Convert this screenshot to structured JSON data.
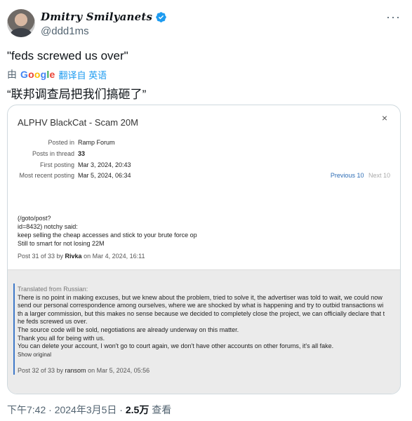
{
  "tweet": {
    "display_name": "Dmitry Smilyanets",
    "handle": "@ddd1ms",
    "more_icon": "ellipsis-icon",
    "text": "\"feds screwed us over\"",
    "translate_by": "由",
    "translate_brand": "Google",
    "translate_link": "翻译自 英语",
    "translated_text": "“联邦调查局把我们搞砸了”",
    "footer_time": "下午7:42 · 2024年3月5日 · ",
    "footer_views_count": "2.5万",
    "footer_views_label": " 查看"
  },
  "card": {
    "title": "ALPHV BlackCat - Scam 20M",
    "close_label": "×",
    "info": [
      {
        "label": "Posted in",
        "value": "Ramp Forum"
      },
      {
        "label": "Posts in thread",
        "value": "33"
      },
      {
        "label": "First posting",
        "value": "Mar 3, 2024, 20:43"
      },
      {
        "label": "Most recent posting",
        "value": "Mar 5, 2024, 06:34"
      }
    ],
    "prev_label": "Previous 10",
    "next_label": "Next 10",
    "post1": {
      "lines": [
        "(/goto/post?",
        "id=8432) notchy said:",
        "keep selling the cheap accesses and stick to your brute force op",
        "Still to smart for not losing 22M"
      ],
      "meta_prefix": "Post 31 of 33 by ",
      "meta_author": "Rivka",
      "meta_suffix": " on Mar 4, 2024, 16:11"
    },
    "post2": {
      "translated_from": "Translated from Russian:",
      "lines": [
        "There is no point in making excuses, but we knew about the problem, tried to solve it, the advertiser was told to wait, we could now",
        "send our personal correspondence among ourselves, where we are shocked by what is happening and try to outbid transactions wi",
        "th a larger commission, but this makes no sense because we decided to completely close the project, we can officially declare that t",
        "he feds screwed us over.",
        " The source code will be sold, negotiations are already underway on this matter.",
        " Thank you all for being with us.",
        " You can delete your account, I won't go to court again, we don't have other accounts on other forums, it's all fake."
      ],
      "show_original": "Show original",
      "meta_prefix": "Post 32 of 33 by ",
      "meta_author": "ransom",
      "meta_suffix": " on Mar 5, 2024, 05:56"
    }
  },
  "colors": {
    "link_blue": "#1d9bf0",
    "verified_blue": "#1d9bf0",
    "forum_link": "#2d6db5",
    "quote_bar": "#3f79c9"
  }
}
